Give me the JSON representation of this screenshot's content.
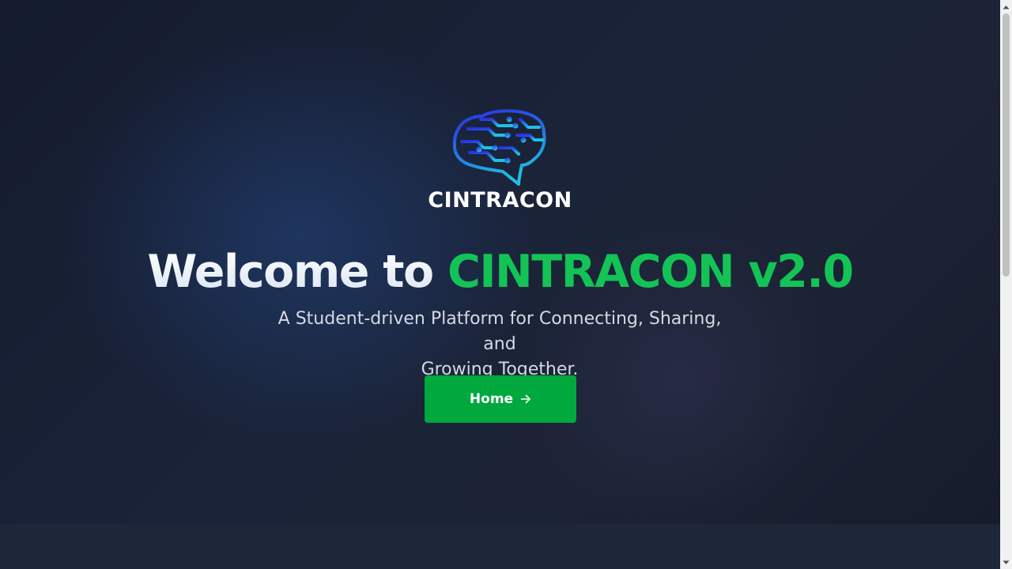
{
  "brand": {
    "logo_icon": "brain-circuit-icon",
    "name": "CINTRACON",
    "gradient_colors": [
      "#2436e0",
      "#1fb8e0"
    ]
  },
  "hero": {
    "headline_prefix": "Welcome to",
    "headline_highlight": "CINTRACON v2.0",
    "subtitle_line1": "A Student-driven Platform for Connecting, Sharing, and",
    "subtitle_line2": "Growing Together.",
    "home_button_label": "Home",
    "home_button_icon": "arrow-right-icon"
  },
  "colors": {
    "accent_green": "#13c356",
    "button_green": "#00a83d",
    "background": "#1a2235"
  },
  "scrollbar": {
    "up_icon": "scroll-up-arrow-icon",
    "down_icon": "scroll-down-arrow-icon"
  }
}
